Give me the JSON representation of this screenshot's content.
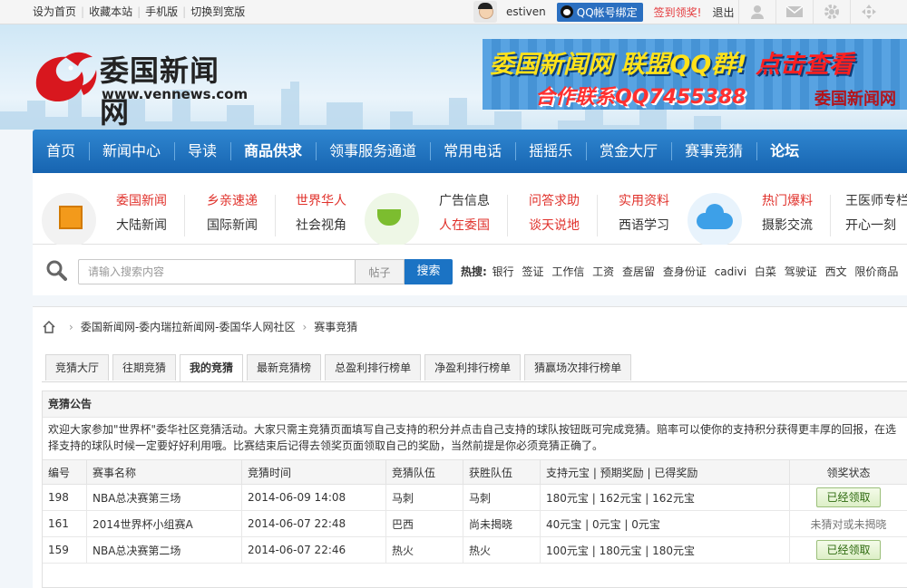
{
  "topbar": {
    "links": [
      "设为首页",
      "收藏本站",
      "手机版",
      "切换到宽版"
    ],
    "username": "estiven",
    "qq_bind": "QQ帐号绑定",
    "signin": "签到领奖!",
    "logout": "退出"
  },
  "logo": {
    "cn": "委国新闻网",
    "en": "www.vennews.com"
  },
  "ad": {
    "line1_a": "委国新闻网 联盟QQ群!",
    "line1_b": "点击查看",
    "line2": "合作联系QQ7455388",
    "line3": "委国新闻网"
  },
  "mainnav": {
    "items": [
      "首页",
      "新闻中心",
      "导读",
      "商品供求",
      "领事服务通道",
      "常用电话",
      "摇摇乐",
      "赏金大厅",
      "赛事竞猜",
      "论坛"
    ]
  },
  "subnav": {
    "cols": [
      {
        "top": "委国新闻",
        "bottom": "大陆新闻"
      },
      {
        "top": "乡亲速递",
        "bottom": "国际新闻"
      },
      {
        "top": "世界华人",
        "bottom": "社会视角"
      },
      {
        "top": "广告信息",
        "bottom": "人在委国"
      },
      {
        "top": "问答求助",
        "bottom": "谈天说地"
      },
      {
        "top": "实用资料",
        "bottom": "西语学习"
      },
      {
        "top": "热门爆料",
        "bottom": "摄影交流"
      },
      {
        "top": "王医师专栏",
        "bottom": "开心一刻"
      }
    ]
  },
  "search": {
    "placeholder": "请输入搜索内容",
    "type": "帖子",
    "button": "搜索",
    "hot_label": "热搜:",
    "hot": [
      "银行",
      "签证",
      "工作信",
      "工资",
      "查居留",
      "查身份证",
      "cadivi",
      "白菜",
      "驾驶证",
      "西文",
      "限价商品"
    ]
  },
  "breadcrumb": {
    "site": "委国新闻网-委内瑞拉新闻网-委国华人网社区",
    "current": "赛事竞猜"
  },
  "tabs": [
    "竞猜大厅",
    "往期竞猜",
    "我的竞猜",
    "最新竞猜榜",
    "总盈利排行榜单",
    "净盈利排行榜单",
    "猜赢场次排行榜单"
  ],
  "panel": {
    "title": "竞猜公告",
    "notice": "欢迎大家参加\"世界杯\"委华社区竞猜活动。大家只需主竞猜页面填写自己支持的积分并点击自己支持的球队按钮既可完成竞猜。赔率可以使你的支持积分获得更丰厚的回报，在选择支持的球队时候一定要好好利用哦。比赛结束后记得去领奖页面领取自己的奖励，当然前提是你必须竞猜正确了。"
  },
  "table": {
    "headers": [
      "编号",
      "赛事名称",
      "竞猜时间",
      "竞猜队伍",
      "获胜队伍",
      "支持元宝 | 预期奖励 | 已得奖励",
      "领奖状态"
    ],
    "rows": [
      {
        "id": "198",
        "name": "NBA总决赛第三场",
        "time": "2014-06-09 14:08",
        "team": "马刺",
        "winner": "马刺",
        "money": "180元宝 | 162元宝 | 162元宝",
        "status": "已经领取",
        "claimed": true
      },
      {
        "id": "161",
        "name": "2014世界杯小组赛A",
        "time": "2014-06-07 22:48",
        "team": "巴西",
        "winner": "尚未揭晓",
        "money": "40元宝 | 0元宝 | 0元宝",
        "status": "未猜对或未揭晓",
        "claimed": false
      },
      {
        "id": "159",
        "name": "NBA总决赛第二场",
        "time": "2014-06-07 22:46",
        "team": "热火",
        "winner": "热火",
        "money": "100元宝 | 180元宝 | 180元宝",
        "status": "已经领取",
        "claimed": true
      }
    ]
  }
}
